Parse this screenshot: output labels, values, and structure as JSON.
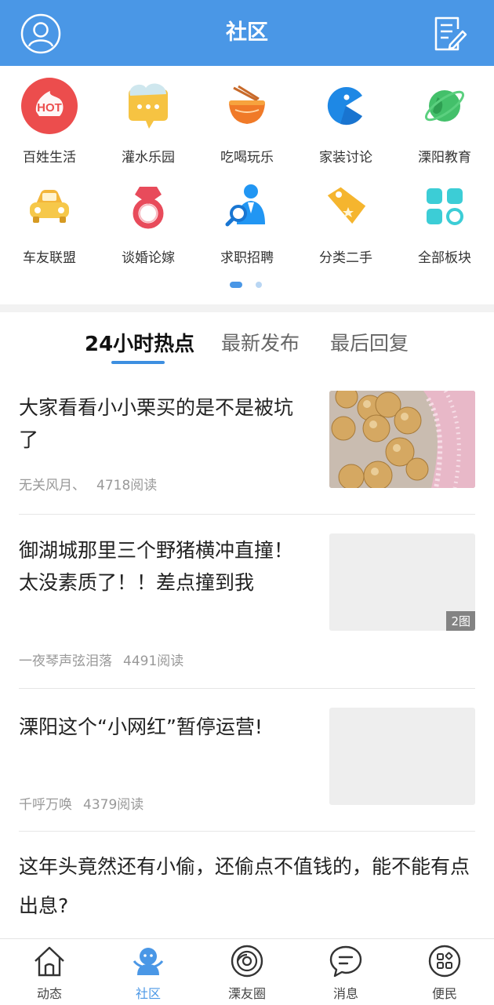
{
  "header": {
    "title": "社区",
    "avatar_icon": "user-icon",
    "compose_icon": "compose-icon"
  },
  "categories": [
    {
      "label": "百姓生活",
      "icon": "hot-icon"
    },
    {
      "label": "灌水乐园",
      "icon": "chat-bubble-icon"
    },
    {
      "label": "吃喝玩乐",
      "icon": "noodle-bowl-icon"
    },
    {
      "label": "家装讨论",
      "icon": "pacman-icon"
    },
    {
      "label": "溧阳教育",
      "icon": "planet-icon"
    },
    {
      "label": "车友联盟",
      "icon": "car-icon"
    },
    {
      "label": "谈婚论嫁",
      "icon": "ring-icon"
    },
    {
      "label": "求职招聘",
      "icon": "job-search-icon"
    },
    {
      "label": "分类二手",
      "icon": "price-tag-icon"
    },
    {
      "label": "全部板块",
      "icon": "grid-icon"
    }
  ],
  "hot_icon_text": "HOT",
  "tabs": [
    {
      "label": "24小时热点",
      "active": true
    },
    {
      "label": "最新发布",
      "active": false
    },
    {
      "label": "最后回复",
      "active": false
    }
  ],
  "articles": [
    {
      "title": "大家看看小小栗买的是不是被坑了",
      "author": "无关风月、",
      "reads": "4718阅读",
      "has_image": true
    },
    {
      "title": "御湖城那里三个野猪横冲直撞！太没素质了！！差点撞到我",
      "author": "一夜琴声弦泪落",
      "reads": "4491阅读",
      "badge": "2图"
    },
    {
      "title": "溧阳这个“小网红”暂停运营!",
      "author": "千呼万唤",
      "reads": "4379阅读"
    },
    {
      "title": "这年头竟然还有小偷，还偷点不值钱的，能不能有点出息?"
    }
  ],
  "bottom_nav": [
    {
      "label": "动态",
      "icon": "home-icon",
      "active": false
    },
    {
      "label": "社区",
      "icon": "community-icon",
      "active": true
    },
    {
      "label": "溧友圈",
      "icon": "circle-icon",
      "active": false
    },
    {
      "label": "消息",
      "icon": "message-icon",
      "active": false
    },
    {
      "label": "便民",
      "icon": "services-icon",
      "active": false
    }
  ],
  "colors": {
    "primary": "#4a97e6",
    "accent_underline": "#3d8fe0"
  }
}
